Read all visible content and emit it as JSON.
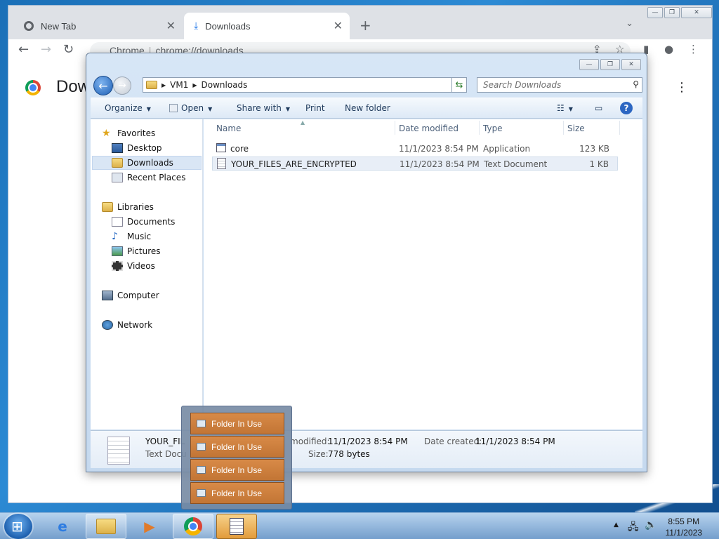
{
  "chrome": {
    "tabs": [
      {
        "label": "New Tab"
      },
      {
        "label": "Downloads"
      }
    ],
    "url_scheme": "Chrome",
    "url": "chrome://downloads",
    "page_title": "Downloads"
  },
  "explorer": {
    "breadcrumb": [
      "VM1",
      "Downloads"
    ],
    "search_placeholder": "Search Downloads",
    "commands": {
      "organize": "Organize",
      "open": "Open",
      "share_with": "Share with",
      "print": "Print",
      "new_folder": "New folder"
    },
    "nav": {
      "favorites": "Favorites",
      "desktop": "Desktop",
      "downloads": "Downloads",
      "recent_places": "Recent Places",
      "libraries": "Libraries",
      "documents": "Documents",
      "music": "Music",
      "pictures": "Pictures",
      "videos": "Videos",
      "computer": "Computer",
      "network": "Network"
    },
    "columns": {
      "name": "Name",
      "date_modified": "Date modified",
      "type": "Type",
      "size": "Size"
    },
    "files": [
      {
        "name": "core",
        "date": "11/1/2023 8:54 PM",
        "type": "Application",
        "size": "123 KB"
      },
      {
        "name": "YOUR_FILES_ARE_ENCRYPTED",
        "date": "11/1/2023 8:54 PM",
        "type": "Text Document",
        "size": "1 KB"
      }
    ],
    "details": {
      "name": "YOUR_FIL",
      "type": "Text Docu",
      "modified_label": "modified:",
      "modified_value": "11/1/2023 8:54 PM",
      "created_label": "Date created:",
      "created_value": "11/1/2023 8:54 PM",
      "size_label": "Size:",
      "size_value": "778 bytes"
    }
  },
  "jumplist": {
    "items": [
      "Folder In Use",
      "Folder In Use",
      "Folder In Use",
      "Folder In Use"
    ]
  },
  "taskbar": {
    "time": "8:55 PM",
    "date": "11/1/2023"
  }
}
